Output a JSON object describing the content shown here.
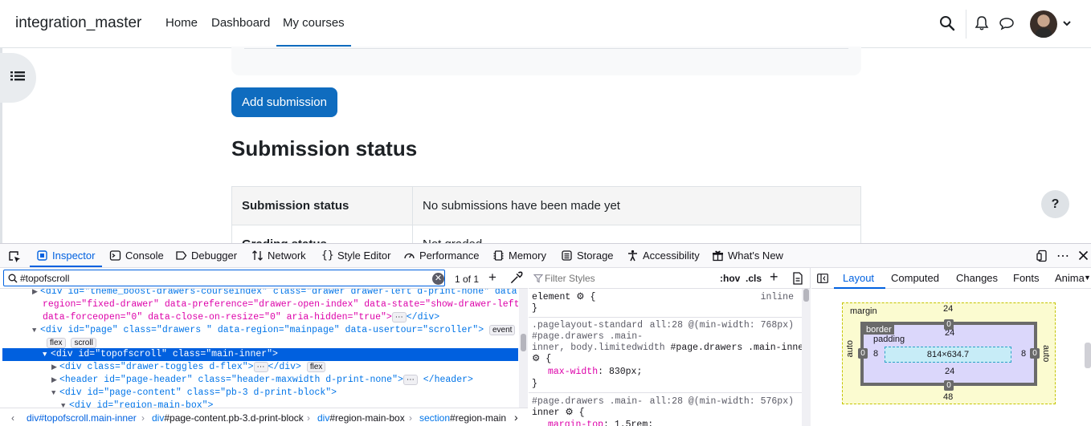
{
  "site": {
    "name": "integration_master",
    "nav": [
      "Home",
      "Dashboard",
      "My courses"
    ],
    "active_nav": "My courses"
  },
  "page": {
    "add_button": "Add submission",
    "section_title": "Submission status",
    "rows": [
      {
        "label": "Submission status",
        "value": "No submissions have been made yet"
      },
      {
        "label": "Grading status",
        "value": "Not graded"
      }
    ],
    "help": "?"
  },
  "devtools": {
    "tabs": [
      "Inspector",
      "Console",
      "Debugger",
      "Network",
      "Style Editor",
      "Performance",
      "Memory",
      "Storage",
      "Accessibility",
      "What's New"
    ],
    "search_value": "#topofscroll",
    "match_count": "1 of 1",
    "tree": {
      "l1a": "<div id=\"theme_boost-drawers-courseindex\" class=\"drawer drawer-left d-print-none\" data-",
      "l1b": "region=\"fixed-drawer\" data-preference=\"drawer-open-index\" data-state=\"show-drawer-left\"",
      "l1c": "data-forceopen=\"0\" data-close-on-resize=\"0\" aria-hidden=\"true\">",
      "l1d": "</div>",
      "l2_open": "<div id=\"page\" class=\"drawers \" data-region=\"mainpage\" data-usertour=\"scroller\">",
      "badge_event": "event",
      "badge_flex": "flex",
      "badge_scroll": "scroll",
      "badge_flex2": "flex",
      "badge_dots": "⋯",
      "selected": "<div id=\"topofscroll\" class=\"main-inner\">",
      "child1": "<div class=\"drawer-toggles d-flex\">",
      "child1_close": "</div>",
      "child2": "<header id=\"page-header\" class=\"header-maxwidth d-print-none\">",
      "child2_close": "</header>",
      "child3": "<div id=\"page-content\" class=\"pb-3 d-print-block\">",
      "child4": "<div id=\"region-main-box\">"
    },
    "breadcrumbs": [
      {
        "tag": "div",
        "rest": "#topofscroll.main-inner"
      },
      {
        "tag": "div",
        "rest": "#page-content.pb-3.d-print-block"
      },
      {
        "tag": "div",
        "rest": "#region-main-box"
      },
      {
        "tag": "section",
        "rest": "#region-main"
      }
    ],
    "rules": {
      "filter_placeholder": "Filter Styles",
      "hov": ":hov",
      "cls": ".cls",
      "element": "element",
      "element_src": "inline",
      "brace_open": "{",
      "brace_close": "}",
      "r1_sel1": ".pagelayout-standard",
      "r1_src": "all:28 @(min-width: 768px)",
      "r1_sel2": "#page.drawers .main-",
      "r1_sel3": "inner, body.limitedwidth #page.drawers .main-inner",
      "r1_prop": "max-width",
      "r1_val": "830px;",
      "r2_sel1": "#page.drawers .main-",
      "r2_src": "all:28 @(min-width: 576px)",
      "r2_sel2": "inner",
      "r2_prop": "margin-top",
      "r2_val": "1.5rem;"
    },
    "layout_tabs": [
      "Layout",
      "Computed",
      "Changes",
      "Fonts",
      "Anima"
    ],
    "boxmodel": {
      "margin_label": "margin",
      "border_label": "border",
      "padding_label": "padding",
      "margin_top": "24",
      "margin_bottom": "48",
      "margin_left": "auto",
      "margin_right": "auto",
      "border_top": "0",
      "border_bottom": "0",
      "border_left": "0",
      "border_right": "0",
      "padding_top": "24",
      "padding_bottom": "24",
      "padding_left": "8",
      "padding_right": "8",
      "content": "814×634.7"
    }
  }
}
